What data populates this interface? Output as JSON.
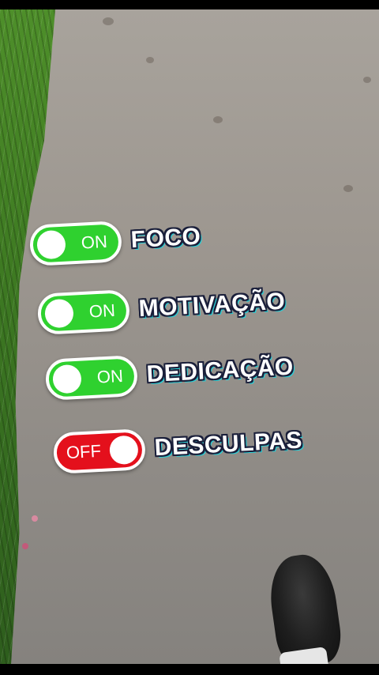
{
  "toggles": [
    {
      "label": "FOCO",
      "state_text": "ON",
      "on": true
    },
    {
      "label": "MOTIVAÇÃO",
      "state_text": "ON",
      "on": true
    },
    {
      "label": "DEDICAÇÃO",
      "state_text": "ON",
      "on": true
    },
    {
      "label": "DESCULPAS",
      "state_text": "OFF",
      "on": false
    }
  ],
  "colors": {
    "on": "#2fd12f",
    "off": "#e4101c",
    "text": "#ffffff"
  }
}
